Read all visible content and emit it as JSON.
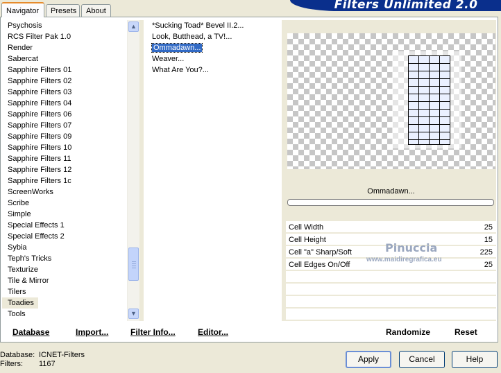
{
  "tabs": [
    {
      "label": "Navigator",
      "active": true
    },
    {
      "label": "Presets",
      "active": false
    },
    {
      "label": "About",
      "active": false
    }
  ],
  "banner": {
    "title": "Filters Unlimited 2.0"
  },
  "categories": [
    "Psychosis",
    "RCS Filter Pak 1.0",
    "Render",
    "Sabercat",
    "Sapphire Filters 01",
    "Sapphire Filters 02",
    "Sapphire Filters 03",
    "Sapphire Filters 04",
    "Sapphire Filters 06",
    "Sapphire Filters 07",
    "Sapphire Filters 09",
    "Sapphire Filters 10",
    "Sapphire Filters 11",
    "Sapphire Filters 12",
    "Sapphire Filters 1c",
    "ScreenWorks",
    "Scribe",
    "Simple",
    "Special Effects 1",
    "Special Effects 2",
    "Sybia",
    "Teph's Tricks",
    "Texturize",
    "Tile & Mirror",
    "Tilers",
    "Toadies",
    "Tools"
  ],
  "selected_category": "Toadies",
  "filters": [
    "*Sucking Toad*  Bevel II.2...",
    "Look, Butthead, a TV!...",
    "Ommadawn...",
    "Weaver...",
    "What Are You?..."
  ],
  "selected_filter": "Ommadawn...",
  "preview": {
    "filter_name": "Ommadawn..."
  },
  "params": [
    {
      "label": "Cell Width",
      "value": "25"
    },
    {
      "label": "Cell Height",
      "value": "15"
    },
    {
      "label": "Cell \"a\" Sharp/Soft",
      "value": "225"
    },
    {
      "label": "Cell Edges On/Off",
      "value": "25"
    }
  ],
  "watermark": {
    "name": "Pinuccia",
    "url": "www.maidiregrafica.eu"
  },
  "toolbar": {
    "database": "Database",
    "import": "Import...",
    "filter_info": "Filter Info...",
    "editor": "Editor...",
    "randomize": "Randomize",
    "reset": "Reset"
  },
  "status": {
    "database_label": "Database:",
    "database_value": "ICNET-Filters",
    "filters_label": "Filters:",
    "filters_value": "1167"
  },
  "buttons": {
    "apply": "Apply",
    "cancel": "Cancel",
    "help": "Help"
  }
}
